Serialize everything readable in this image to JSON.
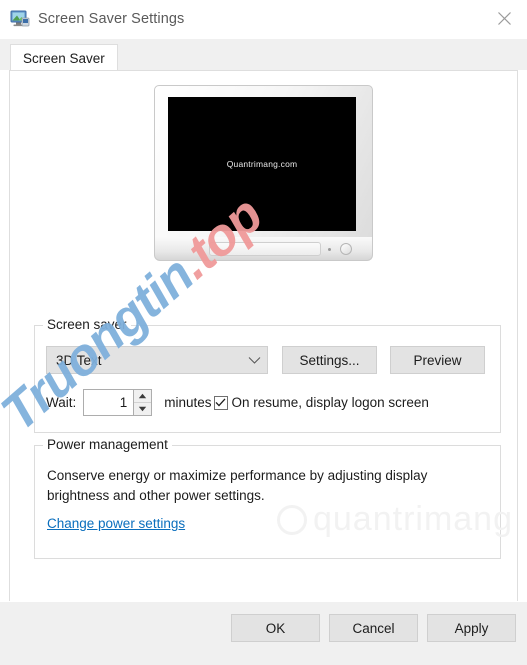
{
  "window": {
    "title": "Screen Saver Settings",
    "icon": "monitor-icon",
    "close_label": "✕"
  },
  "tabs": [
    {
      "label": "Screen Saver",
      "selected": true
    }
  ],
  "preview": {
    "screen_text": "Quantrimang.com",
    "screen_background": "#000000",
    "screen_text_color": "#ffffff"
  },
  "screen_saver_group": {
    "legend": "Screen saver",
    "combo": {
      "value": "3D Text",
      "chevron": "chevron-down-icon"
    },
    "settings_button": "Settings...",
    "preview_button": "Preview",
    "wait_label": "Wait:",
    "wait_value": "1",
    "minutes_label": "minutes",
    "logon_checkbox_checked": true,
    "logon_label": "On resume, display logon screen"
  },
  "power_group": {
    "legend": "Power management",
    "description": "Conserve energy or maximize performance by adjusting display brightness and other power settings.",
    "link": "Change power settings",
    "link_color": "#0a6ebd"
  },
  "footer": {
    "ok": "OK",
    "cancel": "Cancel",
    "apply": "Apply"
  },
  "watermarks": {
    "diagonal_blue": "Truongtin",
    "diagonal_red": ".top",
    "ghost": "quantrimang"
  }
}
